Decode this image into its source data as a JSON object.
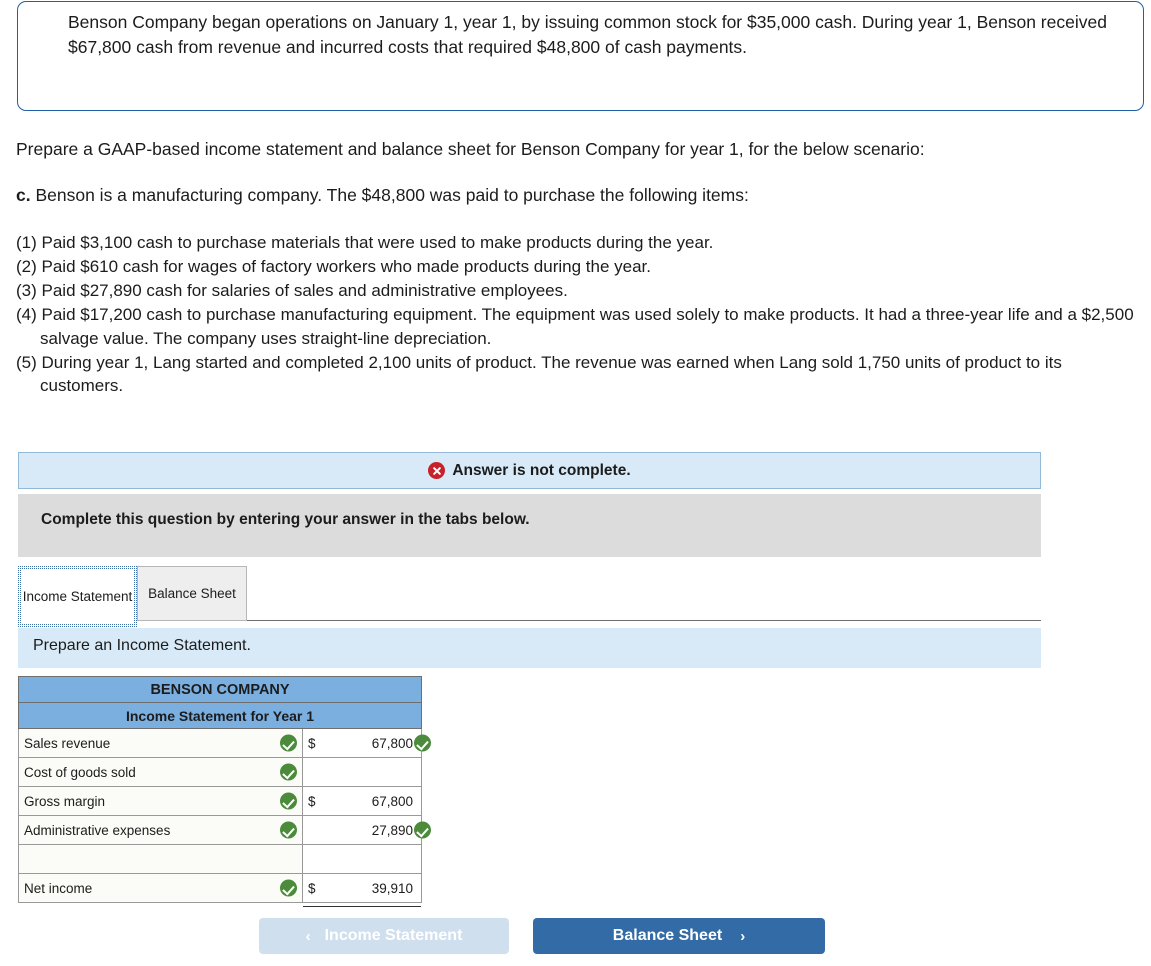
{
  "scenario": {
    "text": "Benson Company began operations on January 1, year 1, by issuing common stock for $35,000 cash. During year 1, Benson received $67,800 cash from revenue and incurred costs that required $48,800 of cash payments."
  },
  "prompt": {
    "main": "Prepare a GAAP-based income statement and balance sheet for Benson Company for year 1, for the below scenario:",
    "sub_label": "c.",
    "sub_text": " Benson is a manufacturing company. The $48,800 was paid to purchase the following items:"
  },
  "items": [
    "(1) Paid $3,100 cash to purchase materials that were used to make products during the year.",
    "(2) Paid $610 cash for wages of factory workers who made products during the year.",
    "(3) Paid $27,890 cash for salaries of sales and administrative employees.",
    "(4) Paid $17,200 cash to purchase manufacturing equipment. The equipment was used solely to make products. It had a three-year life and a $2,500 salvage value. The company uses straight-line depreciation.",
    "(5) During year 1, Lang started and completed 2,100 units of product. The revenue was earned when Lang sold 1,750 units of product to its customers."
  ],
  "status": {
    "icon": "error-x-icon",
    "message": "Answer is not complete.",
    "instruction": "Complete this question by entering your answer in the tabs below."
  },
  "tabs": [
    {
      "label": "Income Statement",
      "active": true
    },
    {
      "label": "Balance Sheet",
      "active": false
    }
  ],
  "sub_header": {
    "text": "Prepare an Income Statement."
  },
  "table": {
    "company": "BENSON COMPANY",
    "title": "Income Statement for Year 1",
    "rows": [
      {
        "label": "Sales revenue",
        "label_check": true,
        "currency": "$",
        "amount": "67,800",
        "amount_check": true,
        "double_rule": false
      },
      {
        "label": "Cost of goods sold",
        "label_check": true,
        "currency": "",
        "amount": "",
        "amount_check": false,
        "double_rule": false
      },
      {
        "label": "Gross margin",
        "label_check": true,
        "currency": "$",
        "amount": "67,800",
        "amount_check": false,
        "double_rule": false
      },
      {
        "label": "Administrative expenses",
        "label_check": true,
        "currency": "",
        "amount": "27,890",
        "amount_check": true,
        "double_rule": false
      },
      {
        "label": "",
        "label_check": false,
        "currency": "",
        "amount": "",
        "amount_check": false,
        "double_rule": false
      },
      {
        "label": "Net income",
        "label_check": true,
        "currency": "$",
        "amount": "39,910",
        "amount_check": false,
        "double_rule": true
      }
    ]
  },
  "footer": {
    "prev_label": "Income Statement",
    "prev_chevron": "‹",
    "next_label": "Balance Sheet",
    "next_chevron": "›"
  },
  "colors": {
    "scenario_border": "#1f5fa8",
    "banner_bg": "#d8eaf8",
    "banner_border": "#93b9d8",
    "grey_strip": "#dcdcdc",
    "table_header_blue": "#7bafe0",
    "check_green": "#4b8b3b",
    "error_red": "#c9212a",
    "btn_primary": "#336ba6",
    "btn_disabled": "#cfdfee"
  }
}
